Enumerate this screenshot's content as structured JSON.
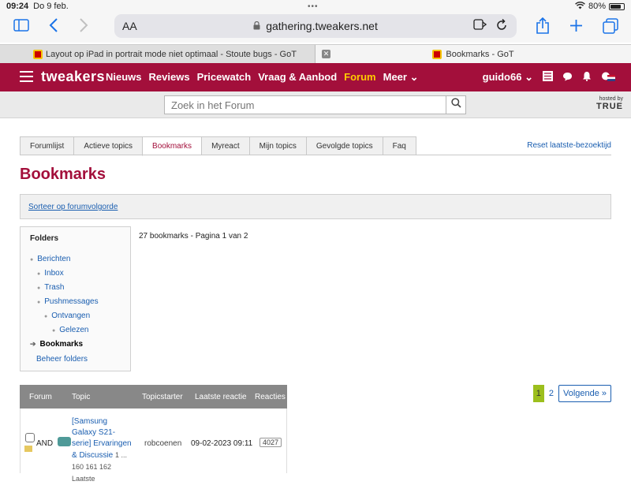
{
  "status_bar": {
    "time": "09:24",
    "date": "Do 9 feb.",
    "battery": "80%",
    "battery_level": 0.8
  },
  "browser": {
    "aa_label": "AA",
    "url": "gathering.tweakers.net",
    "tabs": [
      {
        "label": "Layout op iPad in portrait mode niet optimaal - Stoute bugs - GoT",
        "close": "✕"
      },
      {
        "label": "Bookmarks - GoT"
      }
    ]
  },
  "nav": {
    "logo": "tweakers",
    "links": [
      "Nieuws",
      "Reviews",
      "Pricewatch",
      "Vraag & Aanbod",
      "Forum",
      "Meer"
    ],
    "active_link": "Forum",
    "user": "guido66",
    "accent_color": "#a30f3b"
  },
  "search": {
    "placeholder": "Zoek in het Forum",
    "hosted_by": "hosted by",
    "host_name": "TRUE"
  },
  "subtabs": [
    "Forumlijst",
    "Actieve topics",
    "Bookmarks",
    "Myreact",
    "Mijn topics",
    "Gevolgde topics",
    "Faq"
  ],
  "active_subtab": "Bookmarks",
  "reset_link": "Reset laatste-bezoektijd",
  "page_title": "Bookmarks",
  "sort_link": "Sorteer op forumvolgorde",
  "folders": {
    "title": "Folders",
    "items": [
      {
        "label": "Berichten"
      },
      {
        "label": "Inbox"
      },
      {
        "label": "Trash"
      },
      {
        "label": "Pushmessages"
      },
      {
        "label": "Ontvangen"
      },
      {
        "label": "Gelezen"
      },
      {
        "label": "Bookmarks"
      }
    ],
    "manage": "Beheer folders"
  },
  "bookmark_count": "27 bookmarks - Pagina 1 van 2",
  "pagination": {
    "current": "1",
    "next_page": "2",
    "next_label": "Volgende"
  },
  "table": {
    "headers": [
      "Forum",
      "Topic",
      "Topicstarter",
      "Laatste reactie",
      "Reacties"
    ],
    "rows": [
      {
        "forum": "AND",
        "topic": "[Samsung Galaxy S21-serie] Ervaringen & Discussie",
        "pages": "1 ... 160 161 162 Laatste",
        "starter": "robcoenen",
        "last_reply": "09-02-2023 09:11",
        "replies": "4027"
      }
    ]
  }
}
